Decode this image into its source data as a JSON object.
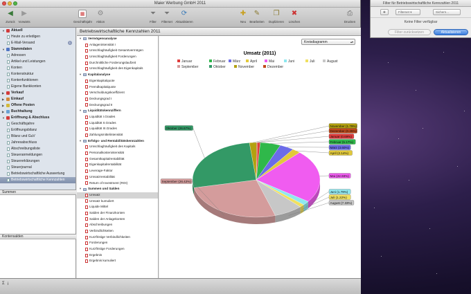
{
  "window": {
    "title": "Maier Werbung GmbH 2011"
  },
  "toolbar": {
    "back": "Zurück",
    "forward": "Vorwärts",
    "fiscal_year": "Geschäftsjahr",
    "action": "Aktion",
    "filter": "Filter",
    "filter_set": "Filterset",
    "refresh": "Aktualisieren",
    "new": "Neu",
    "edit": "Bearbeiten",
    "duplicate": "Duplizieren",
    "delete": "Löschen",
    "print": "Drucken"
  },
  "sidebar": {
    "groups": [
      {
        "label": "Aktuell",
        "color": "#d23b3b",
        "expanded": true,
        "items": [
          {
            "label": "Heute zu erledigen"
          },
          {
            "label": "E-Mail-Versand",
            "badge": "1"
          }
        ]
      },
      {
        "label": "Stammdaten",
        "color": "#5177c4",
        "expanded": true,
        "items": [
          {
            "label": "Adressen"
          },
          {
            "label": "Artikel und Leistungen"
          },
          {
            "label": "Konten"
          },
          {
            "label": "Kontenstruktur"
          },
          {
            "label": "Kontenfunktionen"
          },
          {
            "label": "Eigene Bankkonten"
          }
        ]
      },
      {
        "label": "Verkauf",
        "color": "#d23b3b",
        "expanded": false,
        "items": []
      },
      {
        "label": "Einkauf",
        "color": "#d28a3b",
        "expanded": false,
        "items": []
      },
      {
        "label": "Offene Posten",
        "color": "#d2b93b",
        "expanded": false,
        "items": []
      },
      {
        "label": "Buchhaltung",
        "color": "#6aa0d2",
        "expanded": false,
        "items": []
      },
      {
        "label": "Eröffnung & Abschluss",
        "color": "#d23b3b",
        "expanded": true,
        "items": [
          {
            "label": "Geschäftsjahre"
          },
          {
            "label": "Eröffnungsbilanz"
          },
          {
            "label": "Bilanz und GuV"
          },
          {
            "label": "Jahresabschluss"
          },
          {
            "label": "Abschreibungsliste"
          },
          {
            "label": "Steueranmeldungen"
          },
          {
            "label": "Steuererklärungen"
          },
          {
            "label": "Steuerjournal"
          },
          {
            "label": "Betriebswirtschaftliche Auswertung"
          },
          {
            "label": "Betriebswirtschaftliche Kennzahlen",
            "selected": true
          }
        ]
      }
    ],
    "summen_label": "Summen",
    "kontensalden_label": "Kontensalden"
  },
  "content": {
    "header": "Betriebswirtschaftliche Kennzahlen 2011",
    "tree": [
      {
        "label": "Vermögensanalyse",
        "items": [
          "Anlagenintensität I",
          "Umschlaghäufigkeit Gesamtvermögen",
          "Umschlaghäufigkeit Forderungen",
          "Durchnittliche Forderungslaufzeit",
          "Umschlaghäufigkeit des Eigenkapitals"
        ]
      },
      {
        "label": "Kapitalanalyse",
        "items": [
          "Eigenkapitalquote",
          "Fremdkapitalquote",
          "Verschuldungskoeffizient",
          "Deckungsgrad I",
          "Deckungsgrad II"
        ]
      },
      {
        "label": "Liquiditätskennziffern",
        "items": [
          "Liquidität I.Grades",
          "Liquidität II.Grades",
          "Liquidität III.Grades",
          "Zahlungsmittelintensität"
        ]
      },
      {
        "label": "Erfolgs- und Rentabilitätskennzahlen",
        "items": [
          "Umschlaghäufigkeit des Kapitals",
          "Personalkostenintensität",
          "Gesamtkapitalrentabilität",
          "Eigenkapitalrentabilität",
          "Leverage-Faktor",
          "Umsatzrentabilität",
          "Return of Investment (ROI)"
        ]
      },
      {
        "label": "Summen und Salden",
        "items": [
          "Umsatz",
          "Umsatz kumuliert",
          "Liquide Mittel",
          "Salden der Finanzkonten",
          "Salden der Anlagekonten",
          "Abschreibungen",
          "Verbindlichkeiten",
          "Kurzfristige Verbindlichkeiten",
          "Forderungen",
          "Kurzfristige Forderungen",
          "Ergebnis",
          "Ergebnis kumuliert"
        ]
      }
    ],
    "selected_item": "Umsatz",
    "chart_type_select": "Kreisdiagramm"
  },
  "chart_data": {
    "type": "pie",
    "title": "Umsatz (2011)",
    "categories": [
      "Januar",
      "Februar",
      "März",
      "April",
      "Mai",
      "Juni",
      "Juli",
      "August",
      "September",
      "Oktober",
      "November",
      "Dezember"
    ],
    "values": [
      0.69,
      5.17,
      3.6,
      2.14,
      22.93,
      1.79,
      1.22,
      7.33,
      26.42,
      26.67,
      1.79,
      0.25
    ],
    "labels": [
      "Januar (0.69%)",
      "Februar (5.17%)",
      "März (3.60%)",
      "April (2.14%)",
      "Mai (22.93%)",
      "Juni (1.79%)",
      "Juli (1.22%)",
      "August (7.33%)",
      "September (26.42%)",
      "Oktober (26.67%)",
      "November (1.79%)",
      "Dezember (0.25%)"
    ],
    "colors": [
      "#e03c3c",
      "#2fb84a",
      "#6b6be8",
      "#e2c93a",
      "#f05cf0",
      "#8ee8f0",
      "#f0e060",
      "#c7c7c7",
      "#d49c9c",
      "#339966",
      "#b3a10f",
      "#c04a1a"
    ],
    "legend_position": "top"
  },
  "filter_window": {
    "title": "Filter für Betriebswirtschaftliche Kennzahlen 2011",
    "filterset_label": "Filterset",
    "search_placeholder": "Sichern...",
    "message": "Keine Filter verfügbar",
    "reset_label": "Filter zurücksetzen",
    "refresh_label": "Aktualisieren"
  }
}
